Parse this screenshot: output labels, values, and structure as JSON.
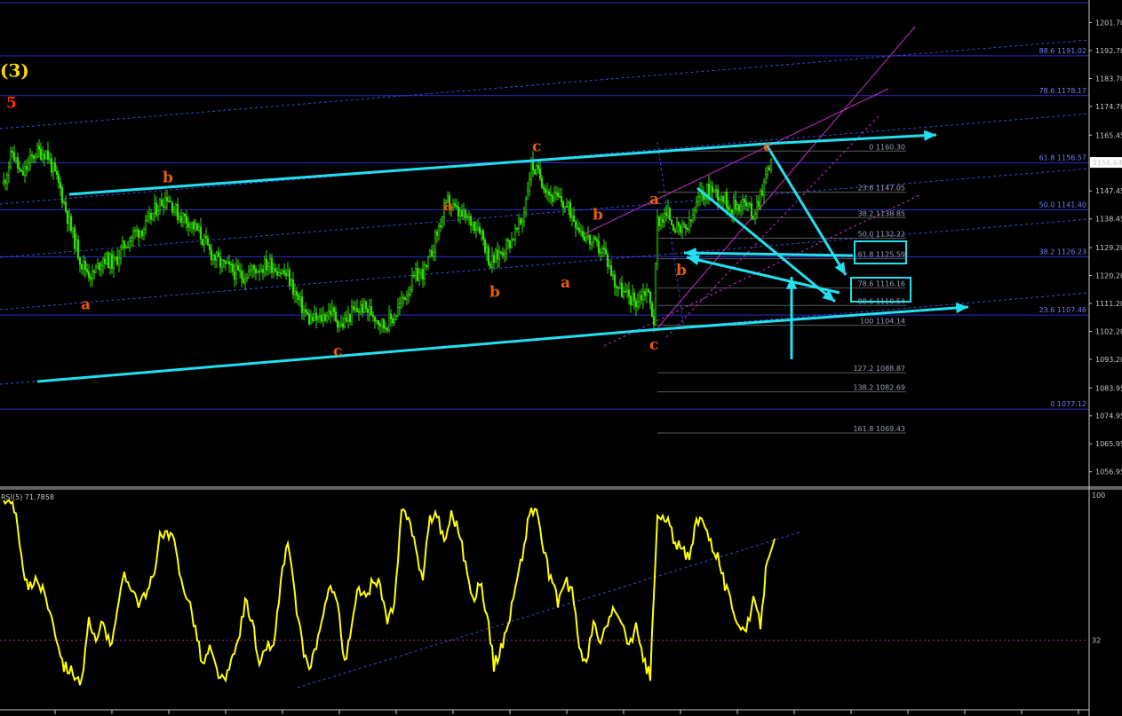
{
  "chart_data": {
    "type": "candlestick",
    "price_axis": {
      "ylim": [
        1052,
        1209
      ],
      "ticks": [
        1201.7,
        1192.7,
        1183.7,
        1174.7,
        1165.45,
        1156.64,
        1147.45,
        1138.45,
        1129.2,
        1120.2,
        1111.2,
        1102.2,
        1093.2,
        1083.95,
        1074.95,
        1065.95,
        1056.95
      ],
      "tick_labels": [
        "1201.70",
        "1192.70",
        "1183.70",
        "1174.70",
        "1165.45",
        "1156.64",
        "1147.45",
        "1138.45",
        "1129.20",
        "1120.20",
        "1111.20",
        "1102.20",
        "1093.20",
        "1083.95",
        "1074.95",
        "1065.95",
        "1056.95"
      ],
      "current_price": "1156.64"
    },
    "fib_levels_right": [
      {
        "label": "88.6 1191.02",
        "price": 1191.02
      },
      {
        "label": "78.6 1178.17",
        "price": 1178.17
      },
      {
        "label": "61.8 1156.57",
        "price": 1156.57
      },
      {
        "label": "50.0 1141.40",
        "price": 1141.4
      },
      {
        "label": "38.2 1126.23",
        "price": 1126.23
      },
      {
        "label": "23.6 1107.46",
        "price": 1107.46
      },
      {
        "label": "0 1077.12",
        "price": 1077.12
      }
    ],
    "fib_levels_inner": [
      {
        "label": "0 1160.30",
        "price": 1160.3
      },
      {
        "label": "23.6 1147.05",
        "price": 1147.05
      },
      {
        "label": "38.2 1138.85",
        "price": 1138.85
      },
      {
        "label": "50.0 1132.22",
        "price": 1132.22
      },
      {
        "label": "61.8 1125.59",
        "price": 1125.59
      },
      {
        "label": "78.6 1116.16",
        "price": 1116.16
      },
      {
        "label": "88.6 1110.54",
        "price": 1110.54
      },
      {
        "label": "100 1104.14",
        "price": 1104.14
      },
      {
        "label": "127.2 1088.87",
        "price": 1088.87
      },
      {
        "label": "138.2 1082.69",
        "price": 1082.69
      },
      {
        "label": "161.8 1069.43",
        "price": 1069.43
      }
    ],
    "boxed_levels": [
      "61.8 1125.59",
      "78.6 1116.16"
    ],
    "wave_labels": [
      {
        "text": "(3)",
        "price": 1186,
        "bar": 0,
        "color": "#ffd800"
      },
      {
        "text": "5",
        "price": 1176,
        "bar": 4,
        "color": "#ff2a00"
      },
      {
        "text": "a",
        "price": 1111,
        "bar": 46,
        "color": "#e85a10"
      },
      {
        "text": "b",
        "price": 1152,
        "bar": 92,
        "color": "#e85a10"
      },
      {
        "text": "c",
        "price": 1096,
        "bar": 188,
        "color": "#e85a10"
      },
      {
        "text": "a",
        "price": 1143,
        "bar": 250,
        "color": "#e85a10"
      },
      {
        "text": "b",
        "price": 1115,
        "bar": 276,
        "color": "#e85a10"
      },
      {
        "text": "c",
        "price": 1162,
        "bar": 300,
        "color": "#e85a10"
      },
      {
        "text": "b",
        "price": 1140,
        "bar": 334,
        "color": "#e85a10"
      },
      {
        "text": "a",
        "price": 1118,
        "bar": 316,
        "color": "#e85a10"
      },
      {
        "text": "a",
        "price": 1145,
        "bar": 366,
        "color": "#e85a10"
      },
      {
        "text": "c",
        "price": 1098,
        "bar": 366,
        "color": "#e85a10"
      },
      {
        "text": "b",
        "price": 1122,
        "bar": 381,
        "color": "#e85a10"
      },
      {
        "text": "c",
        "price": 1162,
        "bar": 430,
        "color": "#e85a10"
      }
    ],
    "price_anchors": [
      [
        0,
        1150
      ],
      [
        5,
        1160
      ],
      [
        10,
        1152
      ],
      [
        18,
        1160
      ],
      [
        24,
        1160
      ],
      [
        32,
        1148
      ],
      [
        38,
        1135
      ],
      [
        44,
        1124
      ],
      [
        50,
        1120
      ],
      [
        56,
        1126
      ],
      [
        62,
        1124
      ],
      [
        68,
        1130
      ],
      [
        74,
        1134
      ],
      [
        80,
        1136
      ],
      [
        86,
        1142
      ],
      [
        92,
        1146
      ],
      [
        98,
        1140
      ],
      [
        104,
        1138
      ],
      [
        110,
        1134
      ],
      [
        116,
        1128
      ],
      [
        122,
        1124
      ],
      [
        128,
        1122
      ],
      [
        134,
        1120
      ],
      [
        140,
        1122
      ],
      [
        150,
        1124
      ],
      [
        160,
        1120
      ],
      [
        166,
        1112
      ],
      [
        172,
        1106
      ],
      [
        178,
        1106
      ],
      [
        184,
        1109
      ],
      [
        190,
        1104
      ],
      [
        196,
        1108
      ],
      [
        202,
        1110
      ],
      [
        208,
        1108
      ],
      [
        214,
        1104
      ],
      [
        220,
        1107
      ],
      [
        226,
        1114
      ],
      [
        232,
        1120
      ],
      [
        238,
        1122
      ],
      [
        244,
        1134
      ],
      [
        250,
        1144
      ],
      [
        256,
        1140
      ],
      [
        262,
        1138
      ],
      [
        268,
        1136
      ],
      [
        274,
        1124
      ],
      [
        280,
        1128
      ],
      [
        286,
        1132
      ],
      [
        292,
        1138
      ],
      [
        297,
        1156
      ],
      [
        302,
        1152
      ],
      [
        308,
        1146
      ],
      [
        314,
        1144
      ],
      [
        320,
        1140
      ],
      [
        326,
        1134
      ],
      [
        332,
        1130
      ],
      [
        338,
        1128
      ],
      [
        344,
        1118
      ],
      [
        350,
        1114
      ],
      [
        356,
        1112
      ],
      [
        362,
        1116
      ],
      [
        366,
        1106
      ],
      [
        368,
        1138
      ],
      [
        374,
        1140
      ],
      [
        380,
        1134
      ],
      [
        386,
        1136
      ],
      [
        392,
        1146
      ],
      [
        398,
        1148
      ],
      [
        404,
        1146
      ],
      [
        410,
        1142
      ],
      [
        416,
        1144
      ],
      [
        422,
        1140
      ],
      [
        428,
        1150
      ],
      [
        432,
        1158
      ]
    ],
    "rsi": {
      "label": "RSI(5) 71.7858",
      "ylim": [
        0,
        100
      ],
      "ticks": [
        "100",
        "32"
      ],
      "level": 32,
      "anchors": [
        [
          0,
          96
        ],
        [
          6,
          95
        ],
        [
          10,
          70
        ],
        [
          14,
          55
        ],
        [
          18,
          62
        ],
        [
          24,
          52
        ],
        [
          28,
          40
        ],
        [
          34,
          20
        ],
        [
          38,
          18
        ],
        [
          44,
          12
        ],
        [
          48,
          40
        ],
        [
          52,
          30
        ],
        [
          56,
          42
        ],
        [
          60,
          28
        ],
        [
          64,
          48
        ],
        [
          68,
          62
        ],
        [
          72,
          58
        ],
        [
          76,
          50
        ],
        [
          80,
          52
        ],
        [
          84,
          62
        ],
        [
          88,
          80
        ],
        [
          92,
          82
        ],
        [
          96,
          78
        ],
        [
          100,
          60
        ],
        [
          104,
          52
        ],
        [
          108,
          38
        ],
        [
          112,
          20
        ],
        [
          116,
          28
        ],
        [
          120,
          18
        ],
        [
          124,
          12
        ],
        [
          128,
          20
        ],
        [
          132,
          32
        ],
        [
          136,
          50
        ],
        [
          140,
          42
        ],
        [
          144,
          18
        ],
        [
          148,
          30
        ],
        [
          152,
          28
        ],
        [
          156,
          60
        ],
        [
          160,
          78
        ],
        [
          164,
          52
        ],
        [
          168,
          30
        ],
        [
          172,
          18
        ],
        [
          176,
          30
        ],
        [
          180,
          42
        ],
        [
          184,
          60
        ],
        [
          188,
          50
        ],
        [
          192,
          20
        ],
        [
          196,
          38
        ],
        [
          200,
          58
        ],
        [
          204,
          50
        ],
        [
          208,
          62
        ],
        [
          212,
          58
        ],
        [
          216,
          40
        ],
        [
          220,
          48
        ],
        [
          224,
          92
        ],
        [
          228,
          92
        ],
        [
          232,
          75
        ],
        [
          236,
          60
        ],
        [
          240,
          90
        ],
        [
          244,
          92
        ],
        [
          248,
          78
        ],
        [
          252,
          92
        ],
        [
          256,
          85
        ],
        [
          260,
          68
        ],
        [
          264,
          50
        ],
        [
          268,
          60
        ],
        [
          272,
          45
        ],
        [
          276,
          20
        ],
        [
          280,
          28
        ],
        [
          284,
          40
        ],
        [
          288,
          56
        ],
        [
          292,
          72
        ],
        [
          296,
          92
        ],
        [
          300,
          94
        ],
        [
          304,
          74
        ],
        [
          308,
          60
        ],
        [
          312,
          50
        ],
        [
          316,
          60
        ],
        [
          320,
          55
        ],
        [
          324,
          30
        ],
        [
          328,
          20
        ],
        [
          332,
          40
        ],
        [
          336,
          30
        ],
        [
          340,
          40
        ],
        [
          344,
          48
        ],
        [
          348,
          38
        ],
        [
          352,
          30
        ],
        [
          356,
          38
        ],
        [
          360,
          22
        ],
        [
          364,
          15
        ],
        [
          368,
          90
        ],
        [
          374,
          88
        ],
        [
          378,
          78
        ],
        [
          382,
          74
        ],
        [
          386,
          70
        ],
        [
          390,
          88
        ],
        [
          394,
          90
        ],
        [
          398,
          78
        ],
        [
          402,
          72
        ],
        [
          406,
          58
        ],
        [
          410,
          48
        ],
        [
          414,
          40
        ],
        [
          418,
          36
        ],
        [
          422,
          50
        ],
        [
          426,
          40
        ],
        [
          430,
          72
        ],
        [
          434,
          82
        ]
      ]
    },
    "colors": {
      "background": "#000000",
      "candle": "#33dd00",
      "wave_label": "#e85a10",
      "degree_label": "#ffd800",
      "top_label": "#ff2a00",
      "channel": "#22e0f0",
      "fib_line": "#2d2dcc",
      "fib_text": "#6f7ff0",
      "inner_fib": "#5a5a5a",
      "pitchfork": "#c030c0",
      "rsi": "#ffff00",
      "axis": "#c8c8c8"
    }
  }
}
